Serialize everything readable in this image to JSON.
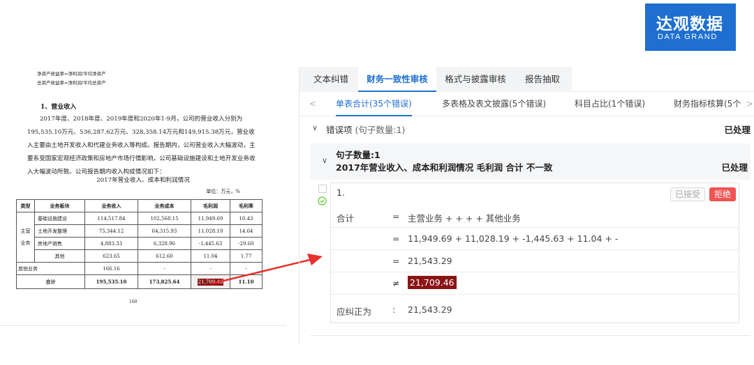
{
  "logo": {
    "cn": "达观数据",
    "en": "DATA GRAND"
  },
  "document": {
    "formula_1": "净资产收益率=净利润/平均净资产",
    "formula_2": "总资产收益率=净利润/平均总资产",
    "section_title": "1、营业收入",
    "paragraph": "2017年度、2018年度、2019年度和2020年1-9月，公司的营业收入分别为195,535.10万元、536,287.62万元、328,358.14万元和149,915.38万元，营业收入主要由土地开发收入和代建业务收入等构成。报告期内，公司营业收入大幅波动，主要系受国家宏观经济政策和房地产市场行情影响，公司基础设施建设和土地开发业务收入大幅波动所致。公司报告期内收入构成情况如下：",
    "table_title": "2017年营业收入、成本和利润情况",
    "unit": "单位：万元，%",
    "headers": [
      "类型",
      "业务板块",
      "业务收入",
      "业务成本",
      "毛利润",
      "毛利率"
    ],
    "group_label": "主营业务",
    "main_rows": [
      [
        "基础设施建设",
        "114,517.84",
        "102,568.15",
        "11,949.69",
        "10.43"
      ],
      [
        "土地开发整理",
        "75,344.12",
        "64,315.93",
        "11,028.19",
        "14.64"
      ],
      [
        "房地产销售",
        "4,883.33",
        "6,328.96",
        "-1,445.63",
        "-29.60"
      ],
      [
        "其他",
        "623.65",
        "612.60",
        "11.04",
        "1.77"
      ]
    ],
    "other_row": [
      "其他业务",
      "166.16",
      "-",
      "-",
      "-"
    ],
    "total_row": [
      "合计",
      "195,535.10",
      "173,825.64",
      "21,709.46",
      "11.10"
    ],
    "page_number": "160"
  },
  "panel": {
    "top_tabs": [
      "文本纠错",
      "财务一致性审核",
      "格式与披露审核",
      "报告抽取"
    ],
    "sub_tabs": [
      "单表合计(35个错误)",
      "多表格及表文披露(5个错误)",
      "科目占比(1个错误)",
      "财务指标核算(5个"
    ],
    "nav_prev": "<",
    "nav_next": ">",
    "error_header": {
      "label": "错误项",
      "count": "(句子数量:1)",
      "status": "已处理"
    },
    "sentence": {
      "title": "句子数量:1",
      "text": "2017年营业收入、成本和利润情况 毛利润 合计 不一致",
      "status": "已处理"
    },
    "card": {
      "number": "1.",
      "accept": "已接受",
      "reject": "拒绝",
      "rows": [
        {
          "key": "合计",
          "op": "=",
          "value": "主营业务 + + + + 其他业务"
        },
        {
          "key": "",
          "op": "=",
          "value": "11,949.69 + 11,028.19 + -1,445.63 + 11.04 + -"
        },
        {
          "key": "",
          "op": "=",
          "value": "21,543.29"
        },
        {
          "key": "",
          "op": "≠",
          "value": "21,709.46"
        },
        {
          "key": "应纠正为",
          "op": ":",
          "value": "21,543.29"
        }
      ]
    }
  },
  "colors": {
    "brand": "#1e6fd0",
    "error": "#8a1414",
    "reject": "#f05454",
    "arrow": "#e8312c"
  },
  "icons": [
    "chevron-down-icon",
    "check-circle-icon",
    "arrow-icon"
  ]
}
